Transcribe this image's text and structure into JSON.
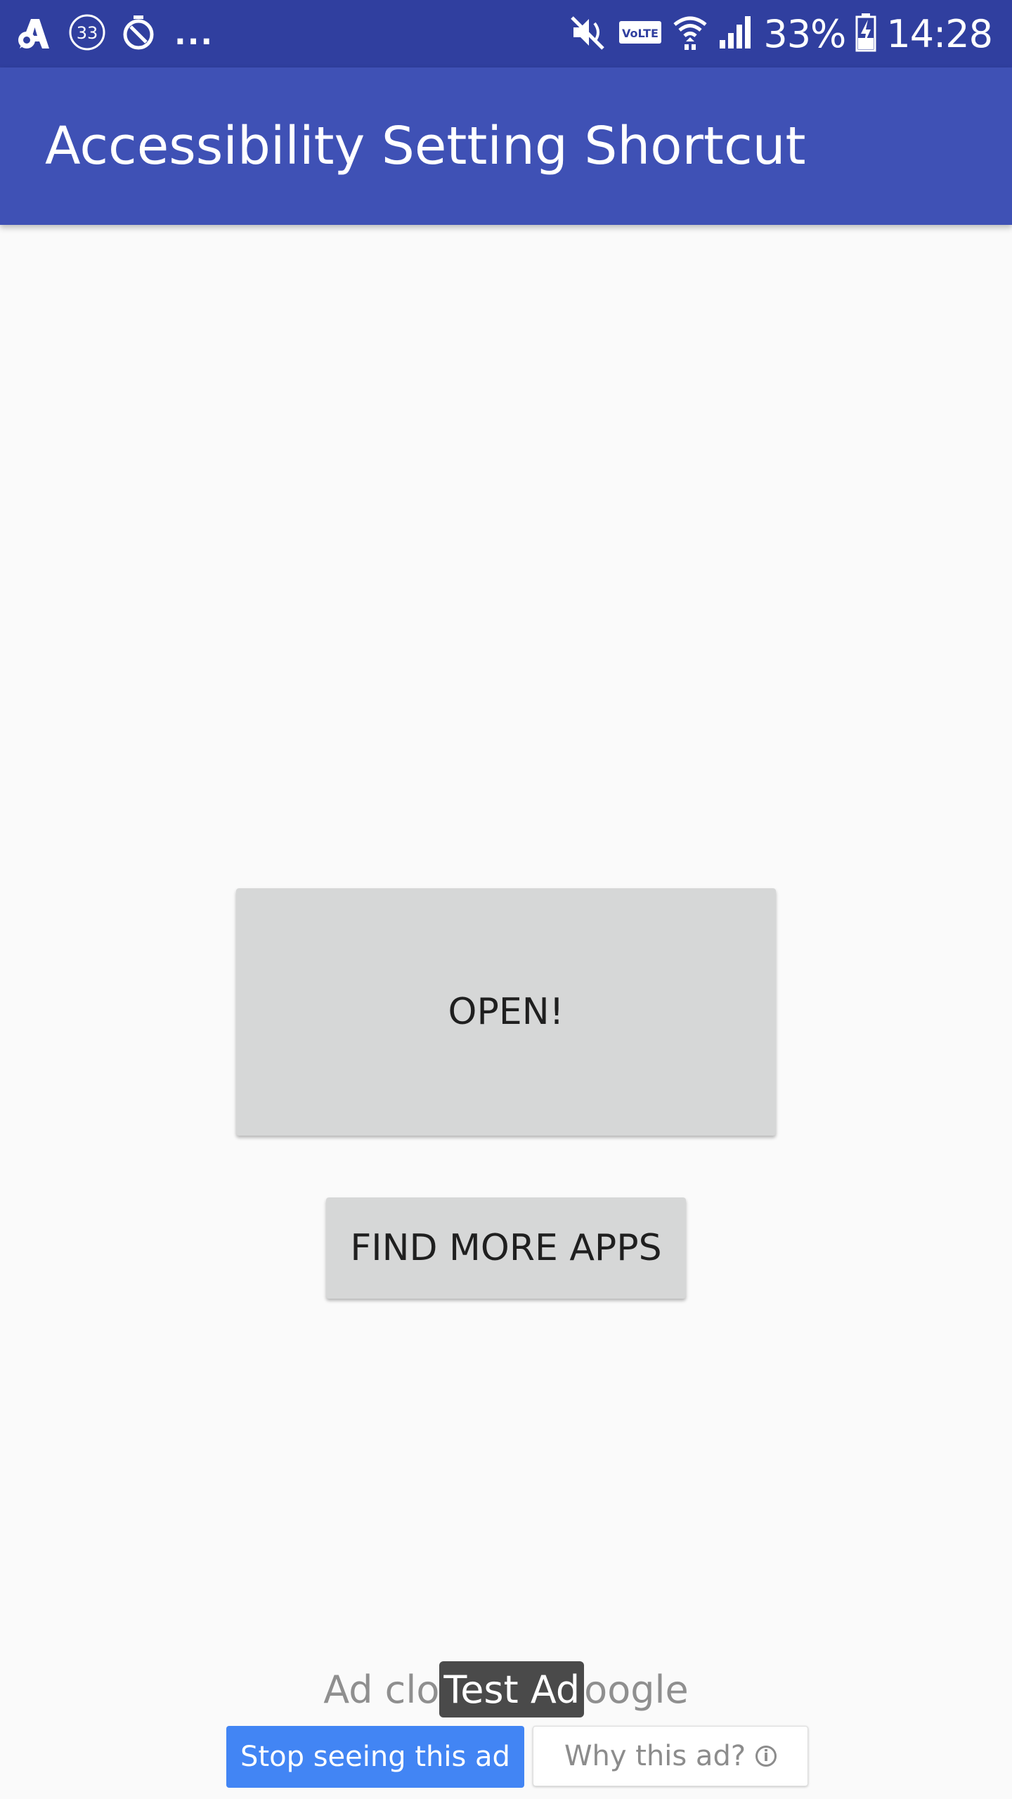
{
  "status_bar": {
    "notification_badge": "33",
    "more_indicator": "...",
    "network_label": "VoLTE",
    "battery_percent": "33%",
    "time": "14:28",
    "icons": [
      "app-notification-icon",
      "data-badge-icon",
      "timer-icon",
      "mute-icon",
      "volte-icon",
      "wifi-icon",
      "signal-icon",
      "battery-charging-icon"
    ]
  },
  "app_bar": {
    "title": "Accessibility Setting Shortcut",
    "color": "#3f51b5"
  },
  "main": {
    "open_button": "OPEN!",
    "find_more_apps_button": "FIND MORE APPS"
  },
  "ad": {
    "closed_text": "Ad clo",
    "test_ad_label": "Test Ad",
    "google_text": "oogle",
    "stop_seeing_button": "Stop seeing this ad",
    "why_button": "Why this ad?",
    "stop_button_color": "#4285f4"
  }
}
